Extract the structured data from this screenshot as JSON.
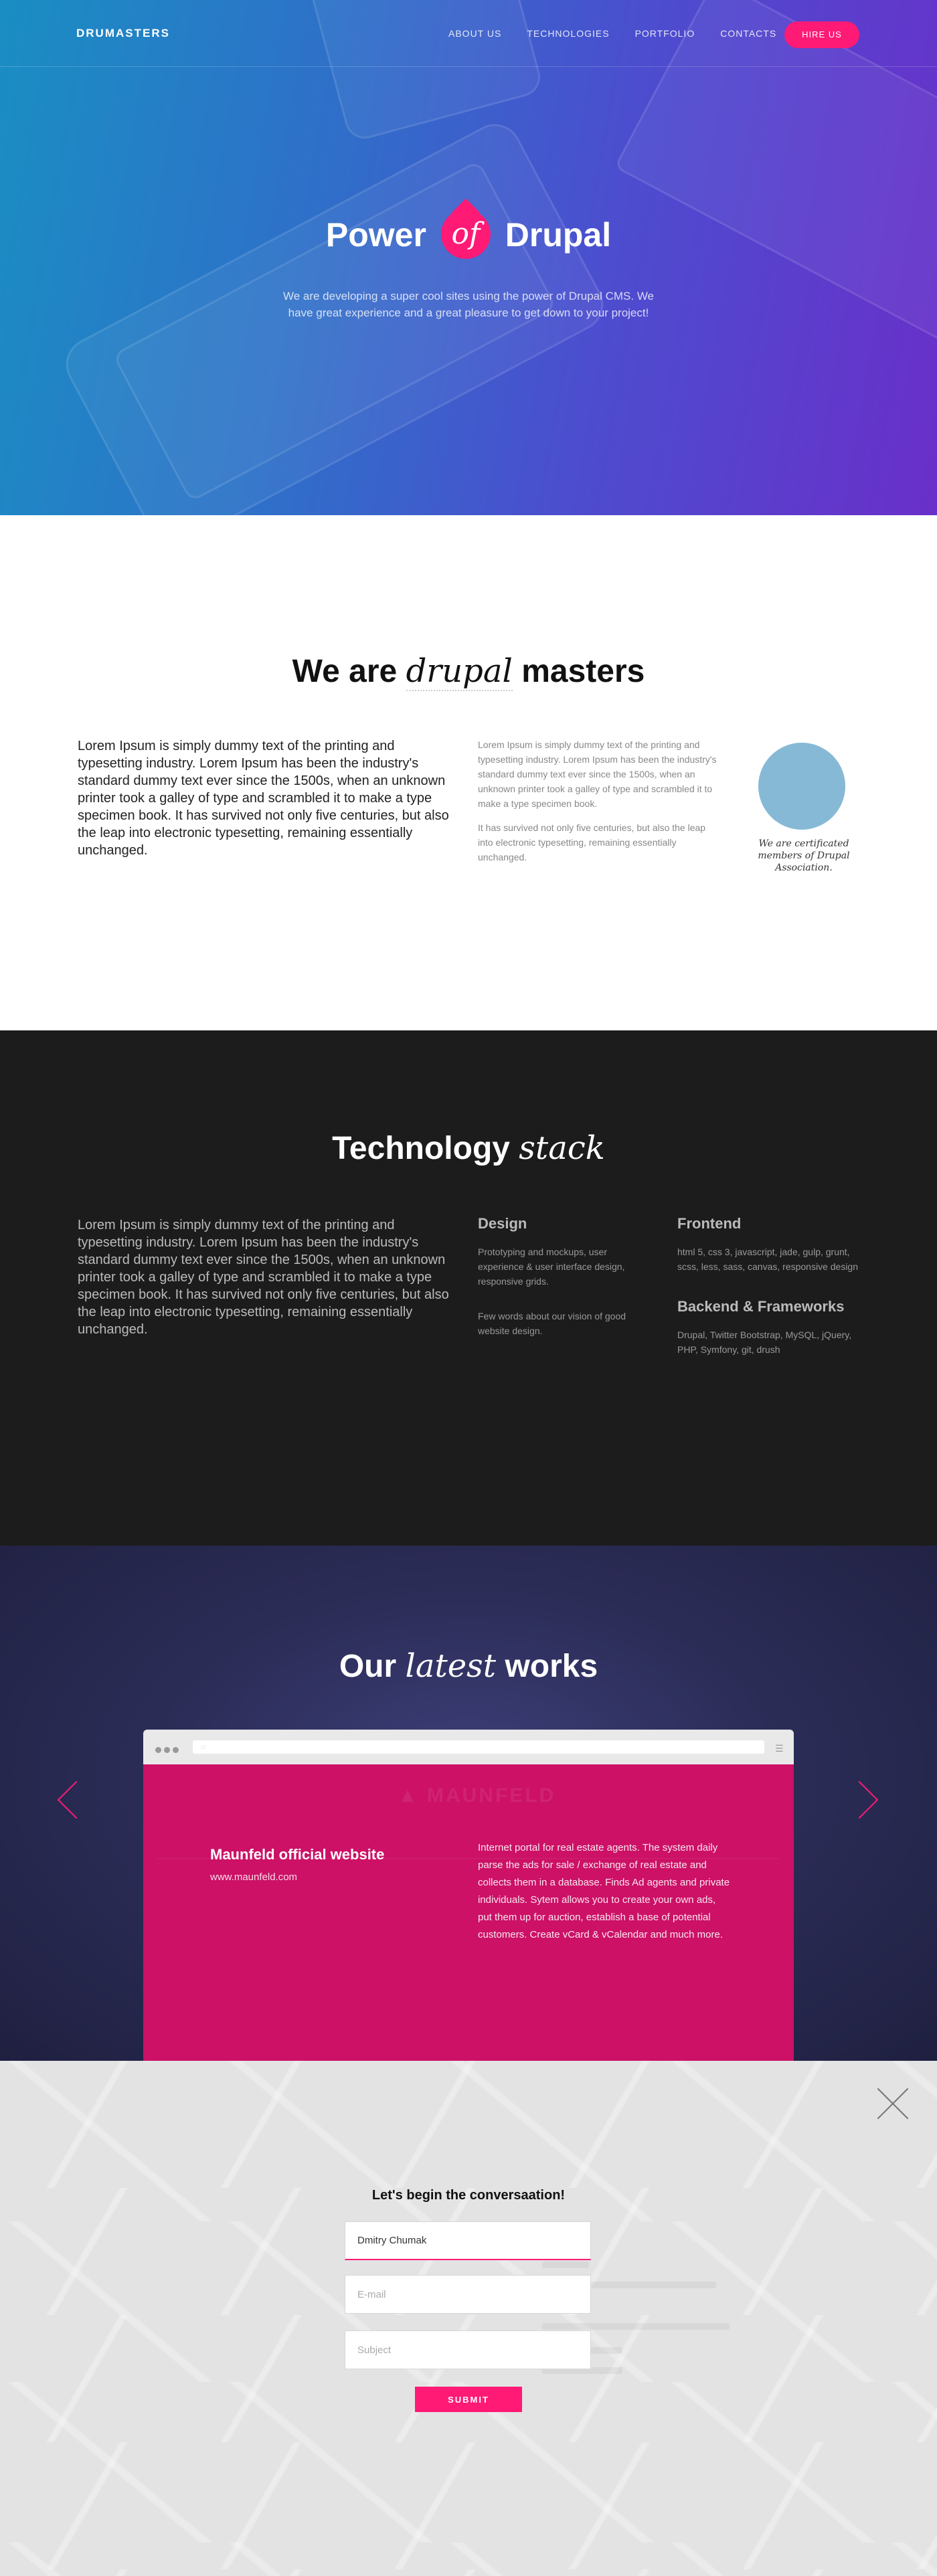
{
  "nav": {
    "logo": "DRUMASTERS",
    "items": [
      "ABOUT US",
      "TECHNOLOGIES",
      "PORTFOLIO",
      "CONTACTS"
    ],
    "hire_label": "HIRE US"
  },
  "hero": {
    "title_before": "Power",
    "title_badge": "of",
    "title_after": "Drupal",
    "subtitle": "We are developing a super cool sites using the power of Drupal CMS. We have great experience and a great pleasure to get down to your project!"
  },
  "about": {
    "title_before": "We are",
    "title_italic": "drupal",
    "title_after": "masters",
    "lead": "Lorem Ipsum is simply dummy text of the printing and typesetting industry. Lorem Ipsum has been the industry's standard dummy text ever since the 1500s, when an unknown printer took a galley of type and scrambled it to make a type specimen book. It has survived not only five centuries, but also the leap into electronic typesetting, remaining essentially unchanged.",
    "col_p1": "Lorem Ipsum is simply dummy text of the printing and typesetting industry. Lorem Ipsum has been the industry's standard dummy text ever since the 1500s, when an unknown printer took a galley of type and scrambled it to make a type specimen book.",
    "col_p2": "It has survived not only five centuries, but also the leap into electronic typesetting, remaining essentially unchanged.",
    "cert": "We are certificated members of Drupal Association.",
    "circle_color": "#86b9d6"
  },
  "tech": {
    "title_before": "Technology",
    "title_italic": "stack",
    "lead": "Lorem Ipsum is simply dummy text of the printing and typesetting industry. Lorem Ipsum has been the industry's standard dummy text ever since the 1500s, when an unknown printer took a galley of type and scrambled it to make a type specimen book. It has survived not only five centuries, but also the leap into electronic typesetting, remaining essentially unchanged.",
    "design_heading": "Design",
    "design_p1": "Prototyping and mockups, user experience & user interface design, responsive grids.",
    "design_p2": "Few words about our vision of good website design.",
    "frontend_heading": "Frontend",
    "frontend_text": "html 5, css 3, javascript, jade, gulp, grunt, scss, less, sass,  canvas, responsive design",
    "backend_heading": "Backend & Frameworks",
    "backend_text": "Drupal, Twitter Bootstrap, MySQL, jQuery, PHP, Symfony, git, drush"
  },
  "works": {
    "title_before": "Our",
    "title_italic": "latest",
    "title_after": "works",
    "browser_menu_icon": "hamburger-icon",
    "project_title": "Maunfeld official website",
    "project_url": "www.maunfeld.com",
    "project_desc": "Internet portal for real estate agents. The system daily parse the ads for sale / exchange of real estate and collects them in a database. Finds Ad agents and private individuals. Sytem allows you to create your own ads, put them up for auction, establish a base of potential customers. Create vCard & vCalendar and much more.",
    "accent": "#ff1a75"
  },
  "contact": {
    "title": "Let's begin the conversaation!",
    "name_value": "Dmitry Chumak",
    "email_placeholder": "E-mail",
    "subject_placeholder": "Subject",
    "submit_label": "SUBMIT"
  }
}
